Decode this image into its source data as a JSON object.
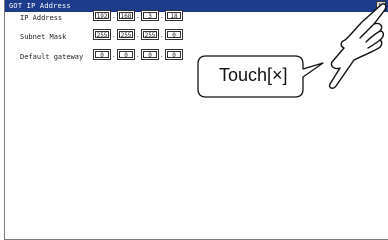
{
  "window": {
    "title": "GOT IP Address",
    "close_label": "×"
  },
  "fields": [
    {
      "label": "IP Address",
      "octets": [
        "192",
        "168",
        "3",
        "18"
      ]
    },
    {
      "label": "Subnet Mask",
      "octets": [
        "255",
        "255",
        "255",
        "0"
      ]
    },
    {
      "label": "Default gateway",
      "octets": [
        "0",
        "0",
        "0",
        "0"
      ]
    }
  ],
  "callout": {
    "text": "Touch[×]"
  },
  "colors": {
    "titlebar": "#1d3c8c",
    "title_text": "#ffffff"
  }
}
